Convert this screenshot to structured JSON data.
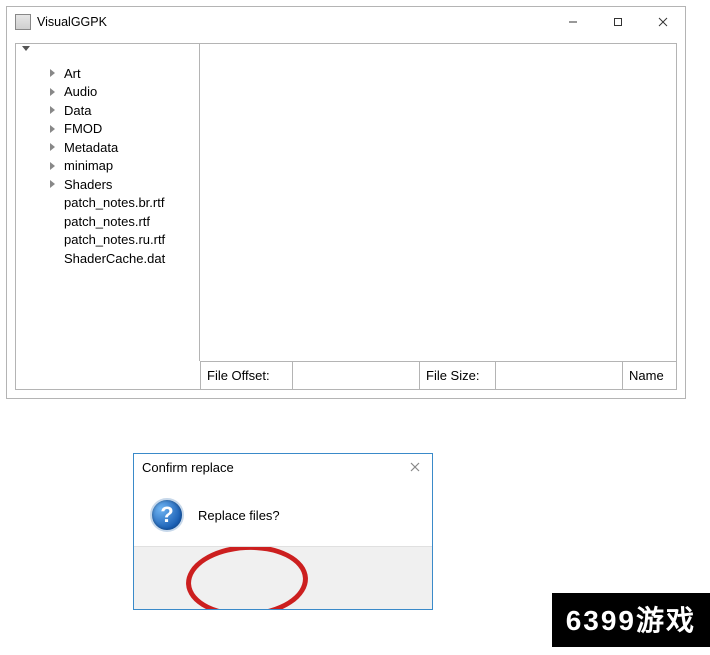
{
  "window": {
    "title": "VisualGGPK"
  },
  "tree": {
    "items": [
      {
        "label": "Art",
        "expandable": true
      },
      {
        "label": "Audio",
        "expandable": true
      },
      {
        "label": "Data",
        "expandable": true
      },
      {
        "label": "FMOD",
        "expandable": true
      },
      {
        "label": "Metadata",
        "expandable": true
      },
      {
        "label": "minimap",
        "expandable": true
      },
      {
        "label": "Shaders",
        "expandable": true
      },
      {
        "label": "patch_notes.br.rtf",
        "expandable": false
      },
      {
        "label": "patch_notes.rtf",
        "expandable": false
      },
      {
        "label": "patch_notes.ru.rtf",
        "expandable": false
      },
      {
        "label": "ShaderCache.dat",
        "expandable": false
      }
    ]
  },
  "status": {
    "file_offset_label": "File Offset:",
    "file_offset_value": "",
    "file_size_label": "File Size:",
    "file_size_value": "",
    "name_label": "Name"
  },
  "dialog": {
    "title": "Confirm replace",
    "message": "Replace files?"
  },
  "watermark": "6399游戏"
}
